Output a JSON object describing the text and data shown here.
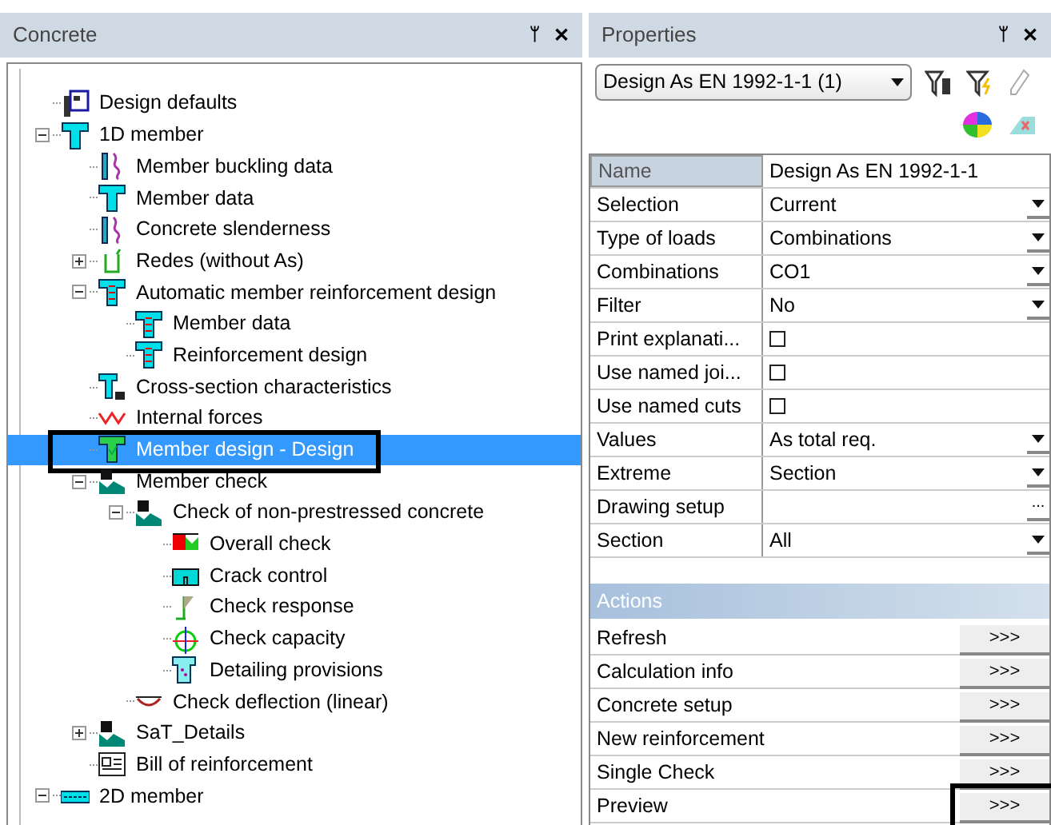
{
  "left_panel": {
    "title": "Concrete",
    "pin": "ᛘ",
    "close": "✕",
    "tree": [
      {
        "label": "Design defaults",
        "kind": "defaults",
        "selected": false
      },
      {
        "label": "1D member",
        "kind": "tee",
        "selected": false,
        "expanded": true,
        "children": [
          {
            "label": "Member buckling data",
            "kind": "buckling",
            "selected": false
          },
          {
            "label": "Member data",
            "kind": "tee",
            "selected": false
          },
          {
            "label": "Concrete slenderness",
            "kind": "buckling",
            "selected": false
          },
          {
            "label": "Redes (without As)",
            "kind": "redes",
            "selected": false,
            "expanded": false
          },
          {
            "label": "Automatic member reinforcement design",
            "kind": "rebar",
            "selected": false,
            "expanded": true,
            "children": [
              {
                "label": "Member data",
                "kind": "rebar",
                "selected": false
              },
              {
                "label": "Reinforcement design",
                "kind": "rebar",
                "selected": false
              }
            ]
          },
          {
            "label": "Cross-section characteristics",
            "kind": "section",
            "selected": false
          },
          {
            "label": "Internal forces",
            "kind": "forces",
            "selected": false
          },
          {
            "label": "Member design - Design",
            "kind": "design",
            "selected": true,
            "highlighted": true
          },
          {
            "label": "Member check",
            "kind": "check",
            "selected": false,
            "expanded": true,
            "children": [
              {
                "label": "Check of non-prestressed concrete",
                "kind": "check",
                "selected": false,
                "expanded": true,
                "children": [
                  {
                    "label": "Overall check",
                    "kind": "overall",
                    "selected": false
                  },
                  {
                    "label": "Crack control",
                    "kind": "crack",
                    "selected": false
                  },
                  {
                    "label": "Check response",
                    "kind": "response",
                    "selected": false
                  },
                  {
                    "label": "Check capacity",
                    "kind": "capacity",
                    "selected": false
                  },
                  {
                    "label": "Detailing provisions",
                    "kind": "detailing",
                    "selected": false
                  }
                ]
              },
              {
                "label": "Check deflection (linear)",
                "kind": "deflection",
                "selected": false
              }
            ]
          },
          {
            "label": "SaT_Details",
            "kind": "check",
            "selected": false,
            "expanded": false
          },
          {
            "label": "Bill of reinforcement",
            "kind": "bill",
            "selected": false
          }
        ]
      },
      {
        "label": "2D member",
        "kind": "slab",
        "selected": false,
        "expanded": true
      }
    ]
  },
  "right_panel": {
    "title": "Properties",
    "pin": "ᛘ",
    "close": "✕",
    "selector": {
      "value": "Design As EN 1992-1-1 (1)"
    },
    "properties": [
      {
        "name": "Name",
        "value": "Design As EN 1992-1-1",
        "kind": "text",
        "selected": true
      },
      {
        "name": "Selection",
        "value": "Current",
        "kind": "dropdown",
        "selected": false
      },
      {
        "name": "Type of loads",
        "value": "Combinations",
        "kind": "dropdown",
        "selected": false
      },
      {
        "name": "Combinations",
        "value": "CO1",
        "kind": "dropdown",
        "selected": false
      },
      {
        "name": "Filter",
        "value": "No",
        "kind": "dropdown",
        "selected": false
      },
      {
        "name": "Print explanati...",
        "kind": "checkbox",
        "checked": false,
        "selected": false
      },
      {
        "name": "Use named joi...",
        "kind": "checkbox",
        "checked": false,
        "selected": false
      },
      {
        "name": "Use named cuts",
        "kind": "checkbox",
        "checked": false,
        "selected": false
      },
      {
        "name": "Values",
        "value": "As total req.",
        "kind": "dropdown",
        "selected": false
      },
      {
        "name": "Extreme",
        "value": "Section",
        "kind": "dropdown",
        "selected": false
      },
      {
        "name": "Drawing setup",
        "kind": "ellipsis",
        "button": "...",
        "selected": false
      },
      {
        "name": "Section",
        "value": "All",
        "kind": "dropdown",
        "selected": false
      }
    ],
    "actions_title": "Actions",
    "actions": [
      {
        "label": "Refresh",
        "button": ">>>",
        "highlighted": false
      },
      {
        "label": "Calculation info",
        "button": ">>>",
        "highlighted": false
      },
      {
        "label": "Concrete setup",
        "button": ">>>",
        "highlighted": false
      },
      {
        "label": "New reinforcement",
        "button": ">>>",
        "highlighted": false
      },
      {
        "label": "Single Check",
        "button": ">>>",
        "highlighted": false
      },
      {
        "label": "Preview",
        "button": ">>>",
        "highlighted": true
      }
    ]
  }
}
